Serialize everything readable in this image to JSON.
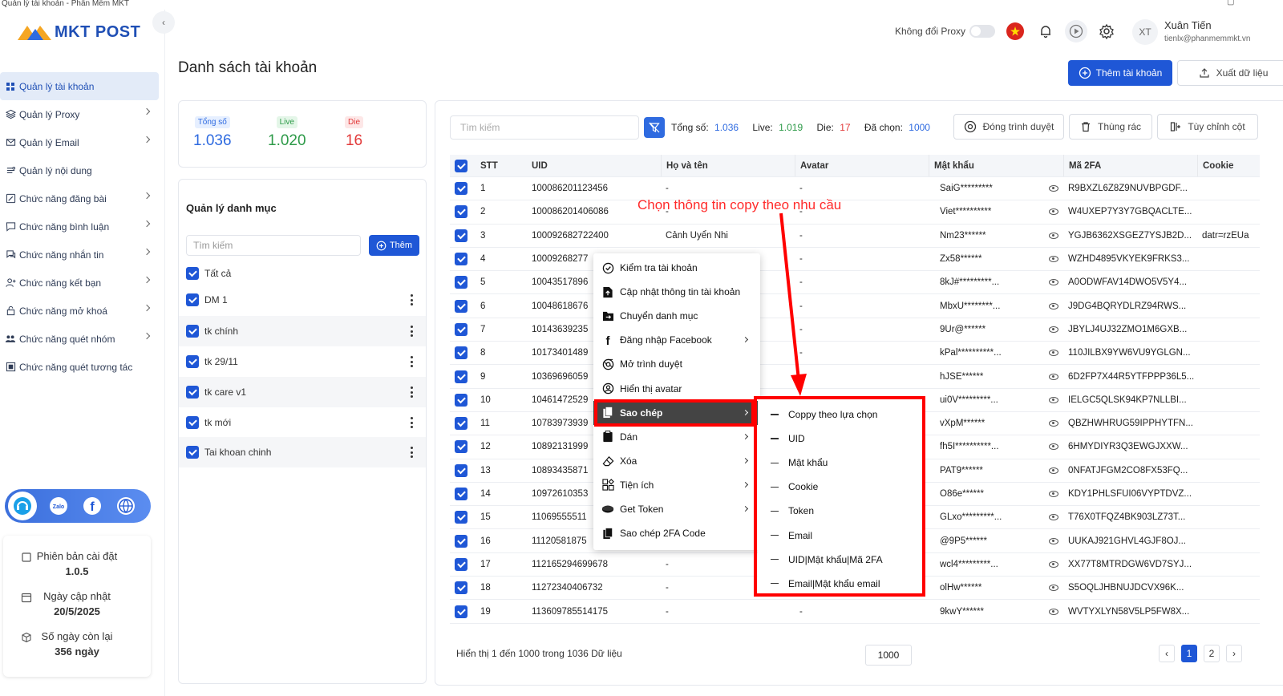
{
  "window": {
    "title": "Quản lý tài khoản - Phần Mềm MKT"
  },
  "brand": {
    "name": "MKT POST",
    "primary_color": "#1f57d6"
  },
  "sidebar": {
    "items": [
      {
        "label": "Quản lý tài khoản",
        "icon": "grid-icon",
        "active": true,
        "has_children": false
      },
      {
        "label": "Quản lý Proxy",
        "icon": "layers-icon",
        "has_children": true
      },
      {
        "label": "Quản lý Email",
        "icon": "mail-icon",
        "has_children": true
      },
      {
        "label": "Quản lý nội dung",
        "icon": "content-icon",
        "has_children": false
      },
      {
        "label": "Chức năng đăng bài",
        "icon": "edit-icon",
        "has_children": true
      },
      {
        "label": "Chức năng bình luận",
        "icon": "comment-icon",
        "has_children": true
      },
      {
        "label": "Chức năng nhắn tin",
        "icon": "chat-icon",
        "has_children": true
      },
      {
        "label": "Chức năng kết bạn",
        "icon": "add-friend-icon",
        "has_children": true
      },
      {
        "label": "Chức năng mở khoá",
        "icon": "unlock-icon",
        "has_children": true
      },
      {
        "label": "Chức năng quét nhóm",
        "icon": "group-icon",
        "has_children": true
      },
      {
        "label": "Chức năng quét tương tác",
        "icon": "interaction-icon",
        "has_children": false
      }
    ],
    "version": {
      "installed_label": "Phiên bản cài đặt",
      "installed_value": "1.0.5",
      "updated_label": "Ngày cập nhật",
      "updated_value": "20/5/2025",
      "remaining_label": "Số ngày còn lại",
      "remaining_value": "356 ngày"
    }
  },
  "header": {
    "proxy_label": "Không đổi Proxy",
    "user_initials": "XT",
    "user_name": "Xuân Tiến",
    "user_email": "tienlx@phanmemmkt.vn"
  },
  "page": {
    "title": "Danh sách tài khoản",
    "add_account": "Thêm tài khoản",
    "export": "Xuất dữ liệu"
  },
  "stats": {
    "total_label": "Tổng số",
    "total_value": "1.036",
    "live_label": "Live",
    "live_value": "1.020",
    "die_label": "Die",
    "die_value": "16"
  },
  "categories": {
    "title": "Quản lý danh mục",
    "search_placeholder": "Tìm kiếm",
    "add_label": "Thêm",
    "items": [
      {
        "label": "Tất cả"
      },
      {
        "label": "DM 1"
      },
      {
        "label": "tk chính"
      },
      {
        "label": "tk 29/11"
      },
      {
        "label": "tk care v1"
      },
      {
        "label": "tk mới"
      },
      {
        "label": "Tai khoan chinh"
      }
    ]
  },
  "toolbar": {
    "search_placeholder": "Tìm kiếm",
    "total_label": "Tổng số:",
    "total_value": "1.036",
    "live_label": "Live:",
    "live_value": "1.019",
    "die_label": "Die:",
    "die_value": "17",
    "selected_label": "Đã chọn:",
    "selected_value": "1000",
    "close_browser": "Đóng trình duyệt",
    "trash": "Thùng rác",
    "customize_columns": "Tùy chỉnh cột"
  },
  "table": {
    "columns": [
      "STT",
      "UID",
      "Họ và tên",
      "Avatar",
      "Mật khẩu",
      "Mã 2FA",
      "Cookie"
    ],
    "rows": [
      {
        "stt": "1",
        "uid": "100086201123456",
        "name": "-",
        "avatar": "-",
        "password": "SaiG*********",
        "twofa": "R9BXZL6Z8Z9NUVBPGDF...",
        "cookie": ""
      },
      {
        "stt": "2",
        "uid": "100086201406086",
        "name": "-",
        "avatar": "-",
        "password": "Viet**********",
        "twofa": "W4UXEP7Y3Y7GBQACLTE...",
        "cookie": ""
      },
      {
        "stt": "3",
        "uid": "100092682722400",
        "name": "Cảnh Uyển Nhi",
        "avatar": "-",
        "password": "Nm23******",
        "twofa": "YGJB6362XSGEZ7YSJB2D...",
        "cookie": "datr=rzEUa"
      },
      {
        "stt": "4",
        "uid": "10009268277",
        "name": "",
        "avatar": "-",
        "password": "Zx58******",
        "twofa": "WZHD4895VKYEK9FRKS3...",
        "cookie": ""
      },
      {
        "stt": "5",
        "uid": "10043517896",
        "name": "",
        "avatar": "-",
        "password": "8kJ#*********...",
        "twofa": "A0ODWFAV14DWO5V5Y4...",
        "cookie": ""
      },
      {
        "stt": "6",
        "uid": "10048618676",
        "name": "",
        "avatar": "-",
        "password": "MbxU********...",
        "twofa": "J9DG4BQRYDLRZ94RWS...",
        "cookie": ""
      },
      {
        "stt": "7",
        "uid": "10143639235",
        "name": "",
        "avatar": "-",
        "password": "9Ur@******",
        "twofa": "JBYLJ4UJ32ZMO1M6GXB...",
        "cookie": ""
      },
      {
        "stt": "8",
        "uid": "10173401489",
        "name": "",
        "avatar": "-",
        "password": "kPal**********...",
        "twofa": "110JILBX9YW6VU9YGLGN...",
        "cookie": ""
      },
      {
        "stt": "9",
        "uid": "10369696059",
        "name": "",
        "avatar": "",
        "password": "hJSE******",
        "twofa": "6D2FP7X44R5YTFPPP36L5...",
        "cookie": ""
      },
      {
        "stt": "10",
        "uid": "10461472529",
        "name": "",
        "avatar": "",
        "password": "ui0V*********...",
        "twofa": "IELGC5QLSK94KP7NLLBI...",
        "cookie": ""
      },
      {
        "stt": "11",
        "uid": "10783973939",
        "name": "",
        "avatar": "",
        "password": "vXpM******",
        "twofa": "QBZHWHRUG59IPPHYTFN...",
        "cookie": ""
      },
      {
        "stt": "12",
        "uid": "10892131999",
        "name": "",
        "avatar": "",
        "password": "fh5I**********...",
        "twofa": "6HMYDIYR3Q3EWGJXXW...",
        "cookie": ""
      },
      {
        "stt": "13",
        "uid": "10893435871",
        "name": "",
        "avatar": "",
        "password": "PAT9******",
        "twofa": "0NFATJFGM2CO8FX53FQ...",
        "cookie": ""
      },
      {
        "stt": "14",
        "uid": "10972610353",
        "name": "",
        "avatar": "",
        "password": "O86e******",
        "twofa": "KDY1PHLSFUI06VYPTDVZ...",
        "cookie": ""
      },
      {
        "stt": "15",
        "uid": "11069555511",
        "name": "",
        "avatar": "",
        "password": "GLxo*********...",
        "twofa": "T76X0TFQZ4BK903LZ73T...",
        "cookie": ""
      },
      {
        "stt": "16",
        "uid": "11120581875",
        "name": "",
        "avatar": "",
        "password": "@9P5******",
        "twofa": "UUKAJ921GHVL4GJF8OJ...",
        "cookie": ""
      },
      {
        "stt": "17",
        "uid": "112165294699678",
        "name": "-",
        "avatar": "",
        "password": "wcl4*********...",
        "twofa": "XX77T8MTRDGW6VD7SYJ...",
        "cookie": ""
      },
      {
        "stt": "18",
        "uid": "11272340406732",
        "name": "-",
        "avatar": "",
        "password": "olHw******",
        "twofa": "S5OQLJHBNUJDCVX96K...",
        "cookie": ""
      },
      {
        "stt": "19",
        "uid": "113609785514175",
        "name": "-",
        "avatar": "-",
        "password": "9kwY******",
        "twofa": "WVTYXLYN58V5LP5FW8X...",
        "cookie": ""
      }
    ]
  },
  "footer": {
    "info": "Hiển thị 1 đến 1000 trong 1036 Dữ liệu",
    "page_size": "1000",
    "pages": [
      "1",
      "2"
    ]
  },
  "context_menu": {
    "items": [
      {
        "label": "Kiểm tra tài khoản",
        "icon": "check-circle-icon",
        "submenu": false
      },
      {
        "label": "Cập nhật thông tin tài khoản",
        "icon": "update-icon",
        "submenu": false
      },
      {
        "label": "Chuyển danh mục",
        "icon": "move-folder-icon",
        "submenu": false
      },
      {
        "label": "Đăng nhập Facebook",
        "icon": "facebook-icon",
        "submenu": true
      },
      {
        "label": "Mở trình duyệt",
        "icon": "browser-icon",
        "submenu": false
      },
      {
        "label": "Hiển thị avatar",
        "icon": "user-circle-icon",
        "submenu": false
      },
      {
        "label": "Sao chép",
        "icon": "copy-icon",
        "submenu": true,
        "highlighted": true
      },
      {
        "label": "Dán",
        "icon": "paste-icon",
        "submenu": true
      },
      {
        "label": "Xóa",
        "icon": "eraser-icon",
        "submenu": true
      },
      {
        "label": "Tiện ích",
        "icon": "widgets-icon",
        "submenu": true
      },
      {
        "label": "Get Token",
        "icon": "token-icon",
        "submenu": true
      },
      {
        "label": "Sao chép 2FA Code",
        "icon": "copy-2fa-icon",
        "submenu": false
      }
    ]
  },
  "copy_submenu": {
    "items": [
      "Coppy theo lựa chọn",
      "UID",
      "Mật khẩu",
      "Cookie",
      "Token",
      "Email",
      "UID|Mật khẩu|Mã 2FA",
      "Email|Mật khẩu email"
    ]
  },
  "annotation": {
    "text": "Chọn thông tin copy theo nhu cầu",
    "color": "#ff0000"
  }
}
